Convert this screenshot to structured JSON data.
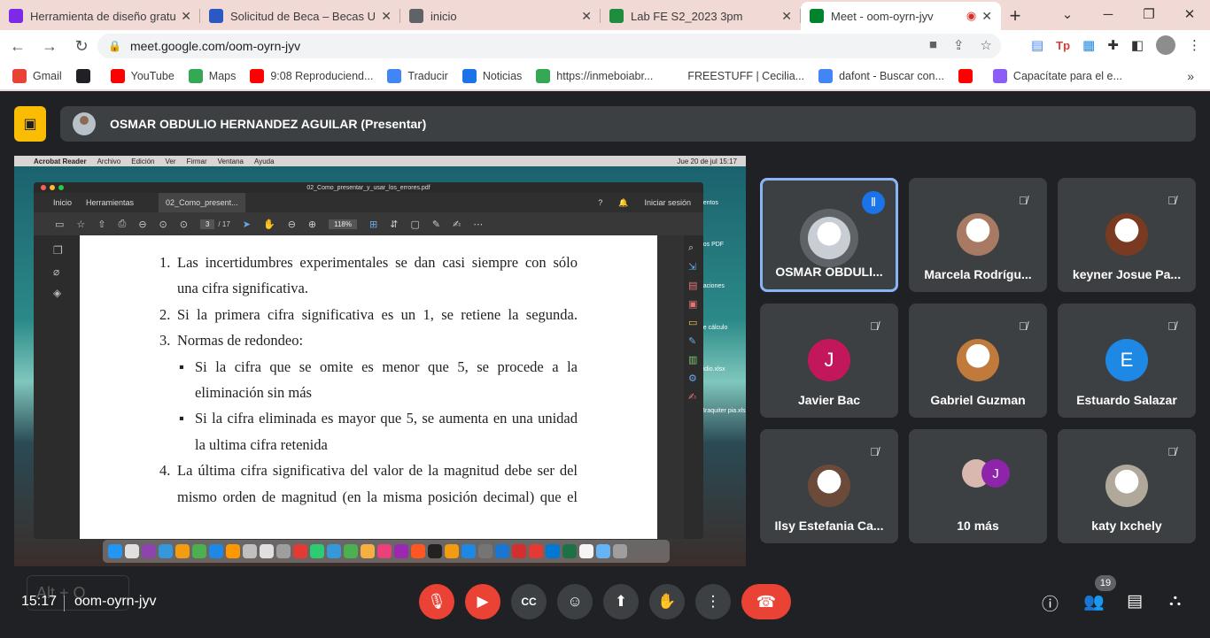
{
  "tabs": [
    {
      "title": "Herramienta de diseño gratu",
      "icon": "canva-icon",
      "color": "#7d2ae8"
    },
    {
      "title": "Solicitud de Beca – Becas US/",
      "icon": "becas-icon",
      "color": "#2b59c3"
    },
    {
      "title": "inicio",
      "icon": "globe-icon",
      "color": "#5f6368"
    },
    {
      "title": "Lab FE S2_2023 3pm",
      "icon": "classroom-icon",
      "color": "#1e8e3e"
    },
    {
      "title": "Meet - oom-oyrn-jyv",
      "icon": "meet-icon",
      "color": "#00832d",
      "active": true
    }
  ],
  "address": {
    "url": "meet.google.com/oom-oyrn-jyv"
  },
  "bookmarks": [
    {
      "label": "Gmail",
      "icon": "gmail-icon",
      "color": "#ea4335"
    },
    {
      "label": "",
      "icon": "globe-dark-icon",
      "color": "#202124"
    },
    {
      "label": "YouTube",
      "icon": "youtube-icon",
      "color": "#ff0000"
    },
    {
      "label": "Maps",
      "icon": "maps-icon",
      "color": "#34a853"
    },
    {
      "label": "9:08 Reproduciend...",
      "icon": "youtube-icon",
      "color": "#ff0000"
    },
    {
      "label": "Traducir",
      "icon": "translate-icon",
      "color": "#4285f4"
    },
    {
      "label": "Noticias",
      "icon": "news-icon",
      "color": "#1a73e8"
    },
    {
      "label": "https://inmeboiabr...",
      "icon": "globe-icon",
      "color": "#34a853"
    },
    {
      "label": "FREESTUFF | Cecilia...",
      "icon": "blank-icon",
      "color": "#ffffff"
    },
    {
      "label": "dafont - Buscar con...",
      "icon": "google-icon",
      "color": "#4285f4"
    },
    {
      "label": "",
      "icon": "youtube-icon",
      "color": "#ff0000"
    },
    {
      "label": "Capacítate para el e...",
      "icon": "edit-icon",
      "color": "#8b5cf6"
    }
  ],
  "presenter": {
    "name": "OSMAR OBDULIO HERNANDEZ AGUILAR (Presentar)"
  },
  "shared_screen": {
    "menubar": [
      "Acrobat Reader",
      "Archivo",
      "Edición",
      "Ver",
      "Firmar",
      "Ventana",
      "Ayuda"
    ],
    "menubar_time": "Jue 20 de jul  15:17",
    "reader_title": "02_Como_presentar_y_usar_los_errores.pdf",
    "reader_tabs": [
      "Inicio",
      "Herramientas",
      "02_Como_present..."
    ],
    "signin": "Iniciar sesión",
    "page_current": "3",
    "page_total": "/ 17",
    "zoom": "118%",
    "desktop_labels": [
      "umentos",
      "entos PDF",
      "entaciones",
      "e de cálculo",
      "e iridio.xlsx",
      "esBraquiter pia.xls"
    ],
    "doc_lines": [
      {
        "num": "1.",
        "text": "Las incertidumbres experimentales se dan casi siempre con sólo"
      },
      {
        "num": "",
        "text": "una cifra significativa."
      },
      {
        "num": "2.",
        "text": "Si la primera cifra significativa es un 1, se retiene la segunda."
      },
      {
        "num": "3.",
        "text": "Normas de redondeo:"
      },
      {
        "num": "▪",
        "text": "Si la cifra que se omite es menor que 5, se procede a la"
      },
      {
        "num": "",
        "text": "eliminación sin más"
      },
      {
        "num": "▪",
        "text": "Si la cifra eliminada es mayor que 5, se aumenta en una unidad"
      },
      {
        "num": "",
        "text": "la ultima cifra retenida"
      },
      {
        "num": "4.",
        "text": "La última cifra significativa del valor de la magnitud debe ser del"
      },
      {
        "num": "",
        "text": "mismo orden de magnitud (en la misma posición decimal) que el"
      }
    ]
  },
  "participants": [
    {
      "name": "OSMAR OBDULI...",
      "speaking": true,
      "avatar": "photo",
      "color": "#c9ced4"
    },
    {
      "name": "Marcela Rodrígu...",
      "muted": true,
      "avatar": "photo",
      "color": "#a97a63"
    },
    {
      "name": "keyner Josue Pa...",
      "muted": true,
      "avatar": "photo",
      "color": "#7a3a22"
    },
    {
      "name": "Javier Bac",
      "muted": true,
      "avatar": "J",
      "color": "#c2185b"
    },
    {
      "name": "Gabriel Guzman",
      "muted": true,
      "avatar": "photo",
      "color": "#c07a3c"
    },
    {
      "name": "Estuardo Salazar",
      "muted": true,
      "avatar": "E",
      "color": "#1e88e5"
    },
    {
      "name": "Ilsy Estefania Ca...",
      "muted": true,
      "avatar": "photo",
      "color": "#6b4a3a"
    },
    {
      "name": "10 más",
      "muted": false,
      "avatar": "group",
      "color": "#8e24aa",
      "group_letter": "J"
    },
    {
      "name": "katy Ixchely",
      "muted": true,
      "avatar": "photo",
      "color": "#b0a89a"
    }
  ],
  "controls": {
    "time": "15:17",
    "meeting_code": "oom-oyrn-jyv",
    "participant_count": "19",
    "shortcut_hint": "Alt + Q"
  }
}
